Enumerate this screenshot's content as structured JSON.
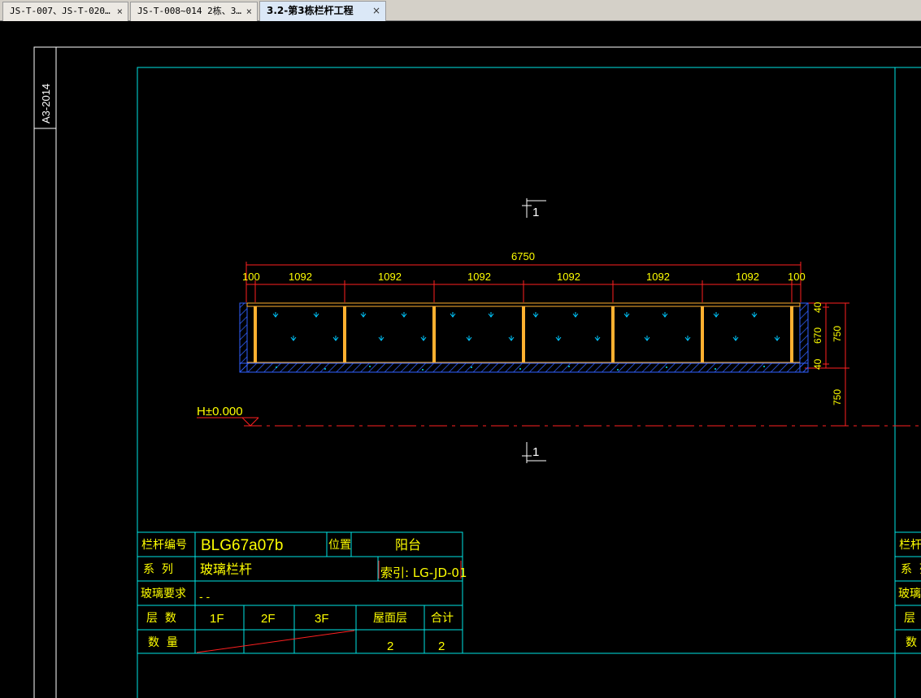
{
  "tabs": [
    {
      "label": "JS-T-007、JS-T-020…",
      "close": "×"
    },
    {
      "label": "JS-T-008~014 2栋、3…",
      "close": "×"
    },
    {
      "label": "3.2-第3栋栏杆工程",
      "close": "×",
      "active": true
    }
  ],
  "drawing": {
    "sheet_size": "A3-2014",
    "section_mark": "1",
    "total_dim": "6750",
    "segment_dims": [
      "100",
      "1092",
      "1092",
      "1092",
      "1092",
      "1092",
      "1092",
      "100"
    ],
    "height_dims": [
      "40",
      "670",
      "40"
    ],
    "height_total": "750",
    "height_above_floor": "750",
    "elevation": "H±0.000"
  },
  "table": {
    "row1": {
      "label": "栏杆编号",
      "code": "BLG67a07b",
      "pos_label": "位置",
      "pos_value": "阳台"
    },
    "row2": {
      "label": "系  列",
      "series": "玻璃栏杆",
      "index": "索引: LG-JD-01"
    },
    "row3": {
      "label": "玻璃要求",
      "value": "- -"
    },
    "row4": {
      "label": "层  数",
      "cols": [
        "1F",
        "2F",
        "3F",
        "屋面层",
        "合计"
      ]
    },
    "row5": {
      "label": "数  量",
      "values": [
        "2",
        "2"
      ]
    }
  },
  "colors": {
    "frame": "#00e5e5",
    "dim": "#ff2020",
    "text": "#ffff00",
    "glass": "#00c8ff",
    "post": "#ffb030",
    "hatch": "#3060ff"
  }
}
